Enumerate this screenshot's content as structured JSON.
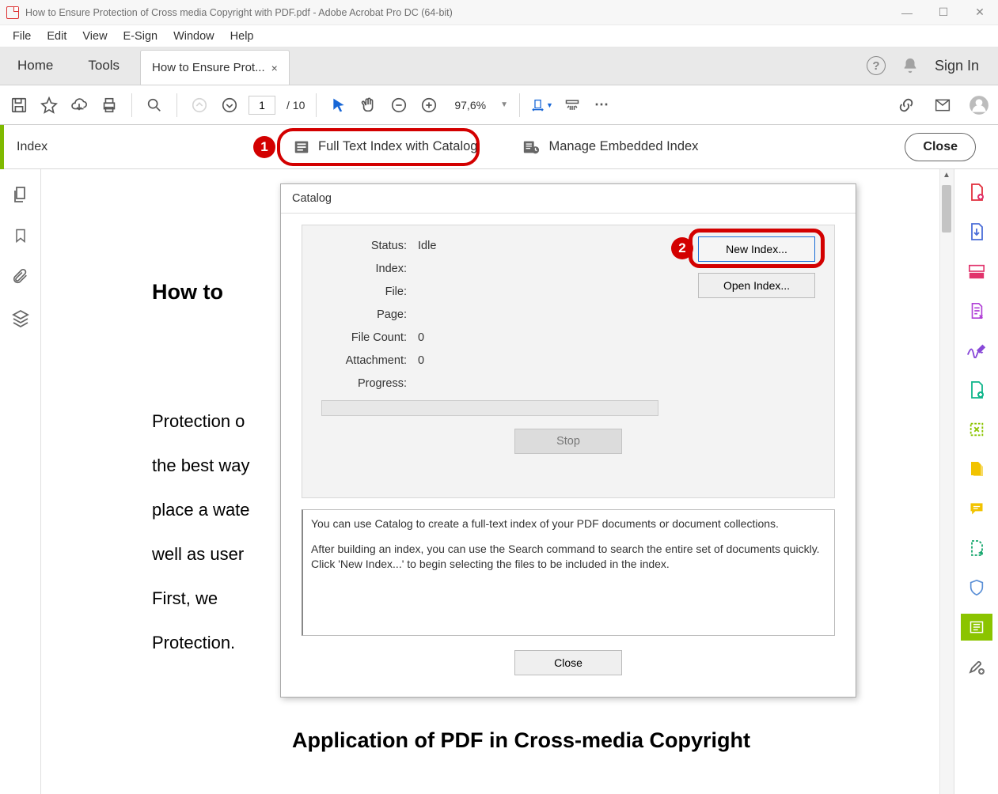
{
  "titlebar": {
    "text": "How to Ensure Protection of Cross media Copyright with PDF.pdf - Adobe Acrobat Pro DC (64-bit)"
  },
  "menu": {
    "file": "File",
    "edit": "Edit",
    "view": "View",
    "esign": "E-Sign",
    "window": "Window",
    "help": "Help"
  },
  "tabs": {
    "home": "Home",
    "tools": "Tools",
    "doc": "How to Ensure Prot...",
    "close": "×",
    "signin": "Sign In"
  },
  "toolbar": {
    "page": "1",
    "page_total": "/ 10",
    "zoom": "97,6%"
  },
  "subbar": {
    "index": "Index",
    "fulltext": "Full Text Index with Catalog",
    "manage": "Manage Embedded Index",
    "close": "Close",
    "marker1": "1"
  },
  "doc": {
    "heading": "How to",
    "p1": "Protection o",
    "p2": "the best way",
    "p3": "place a wate",
    "p4": "well as user",
    "p5": "First,   we",
    "p6": "Protection.",
    "section": "Application of PDF in Cross-media Copyright"
  },
  "dialog": {
    "title": "Catalog",
    "labels": {
      "status": "Status:",
      "index": "Index:",
      "file": "File:",
      "page": "Page:",
      "filecnt": "File Count:",
      "attach": "Attachment:",
      "progress": "Progress:"
    },
    "values": {
      "status": "Idle",
      "filecnt": "0",
      "attach": "0"
    },
    "buttons": {
      "new": "New Index...",
      "open": "Open Index...",
      "stop": "Stop",
      "close": "Close"
    },
    "marker2": "2",
    "info_l1": "You can use Catalog to create a full-text index of your PDF documents or document collections.",
    "info_l2": "After building an index, you can use the Search command to search the entire set of documents quickly.  Click 'New Index...' to begin selecting the files to be included in the index."
  }
}
